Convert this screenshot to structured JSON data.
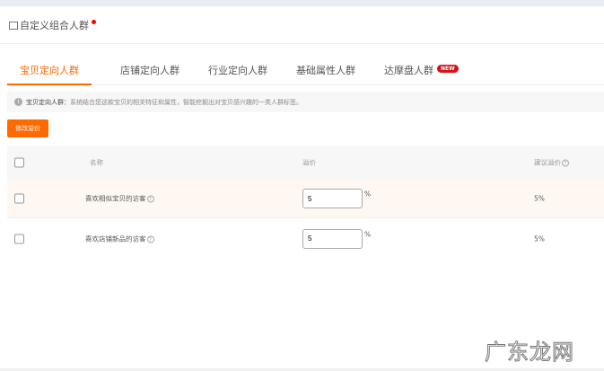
{
  "header": {
    "title": "自定义组合人群"
  },
  "tabs": [
    {
      "label": "宝贝定向人群"
    },
    {
      "label": "店铺定向人群"
    },
    {
      "label": "行业定向人群"
    },
    {
      "label": "基础属性人群"
    },
    {
      "label": "达摩盘人群",
      "badge": "NEW"
    }
  ],
  "info": {
    "label": "宝贝定向人群：",
    "text": "系统结合您这款宝贝的相关特征和属性，智能挖掘出对宝贝感兴趣的一类人群标签。"
  },
  "toolbar": {
    "modify_label": "修改溢价"
  },
  "table": {
    "headers": {
      "name": "名称",
      "premium": "溢价",
      "suggested": "建议溢价"
    },
    "rows": [
      {
        "name": "喜欢相似宝贝的访客",
        "premium": "5",
        "unit": "%",
        "suggested": "5%"
      },
      {
        "name": "喜欢店铺新品的访客",
        "premium": "5",
        "unit": "%",
        "suggested": "5%"
      }
    ]
  },
  "watermark": "广东龙网",
  "colors": {
    "accent": "#ff6a00",
    "badge": "#d3121a"
  }
}
